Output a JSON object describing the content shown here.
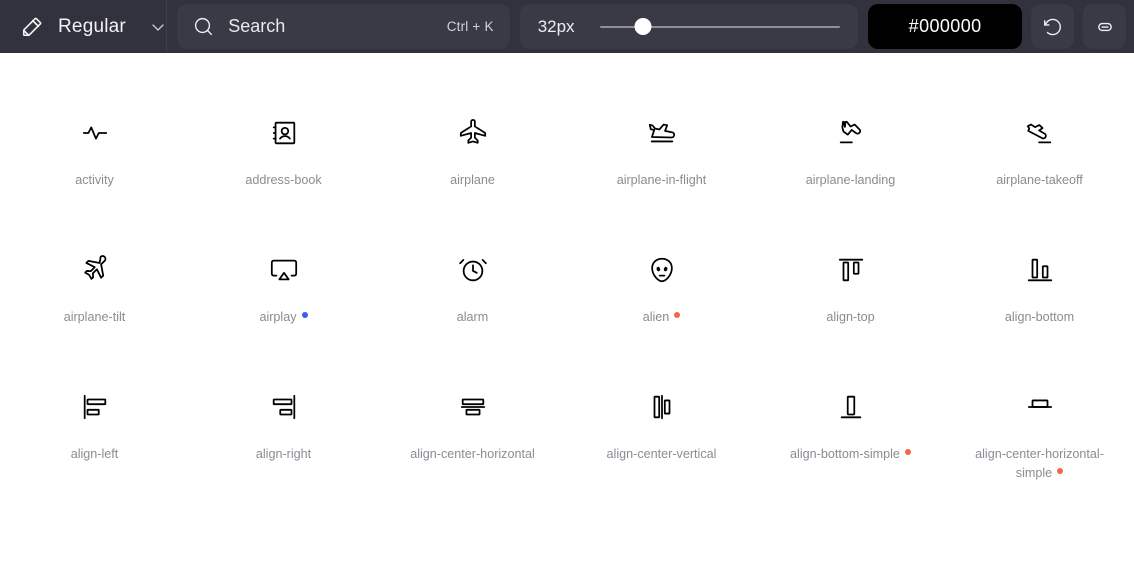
{
  "toolbar": {
    "weight_icon": "pencil-icon",
    "weight_label": "Regular",
    "weight_chevron": "chevron-down-icon",
    "search": {
      "icon": "search-icon",
      "placeholder": "Search",
      "shortcut": "Ctrl + K"
    },
    "size": {
      "value": "32px",
      "slider_percent": 18
    },
    "color": {
      "value": "#000000",
      "hex": "#000000"
    },
    "reset_button": {
      "icon": "reset-arrow-icon",
      "title": "Reset"
    },
    "link_button": {
      "icon": "link-icon",
      "title": "Copy link"
    }
  },
  "grid": {
    "icons": [
      {
        "name": "activity",
        "label": "activity",
        "badge": ""
      },
      {
        "name": "address-book",
        "label": "address-book",
        "badge": ""
      },
      {
        "name": "airplane",
        "label": "airplane",
        "badge": ""
      },
      {
        "name": "airplane-in-flight",
        "label": "airplane-in-flight",
        "badge": ""
      },
      {
        "name": "airplane-landing",
        "label": "airplane-landing",
        "badge": ""
      },
      {
        "name": "airplane-takeoff",
        "label": "airplane-takeoff",
        "badge": ""
      },
      {
        "name": "airplane-tilt",
        "label": "airplane-tilt",
        "badge": ""
      },
      {
        "name": "airplay",
        "label": "airplay",
        "badge": "updated"
      },
      {
        "name": "alarm",
        "label": "alarm",
        "badge": ""
      },
      {
        "name": "alien",
        "label": "alien",
        "badge": "new"
      },
      {
        "name": "align-top",
        "label": "align-top",
        "badge": ""
      },
      {
        "name": "align-bottom",
        "label": "align-bottom",
        "badge": ""
      },
      {
        "name": "align-left",
        "label": "align-left",
        "badge": ""
      },
      {
        "name": "align-right",
        "label": "align-right",
        "badge": ""
      },
      {
        "name": "align-center-horizontal",
        "label": "align-center-horizontal",
        "badge": ""
      },
      {
        "name": "align-center-vertical",
        "label": "align-center-vertical",
        "badge": ""
      },
      {
        "name": "align-bottom-simple",
        "label": "align-bottom-simple",
        "badge": "new"
      },
      {
        "name": "align-center-horizontal-simple",
        "label": "align-center-horizontal-simple",
        "badge": "new"
      }
    ]
  },
  "colors": {
    "toolbar_bg": "#32323e",
    "field_bg": "#3a3a46",
    "page_bg": "#ffffff",
    "icon_color": "#000000",
    "label_color": "#8b8b93",
    "badge_new": "#f2674a",
    "badge_updated": "#3b5bfd"
  }
}
